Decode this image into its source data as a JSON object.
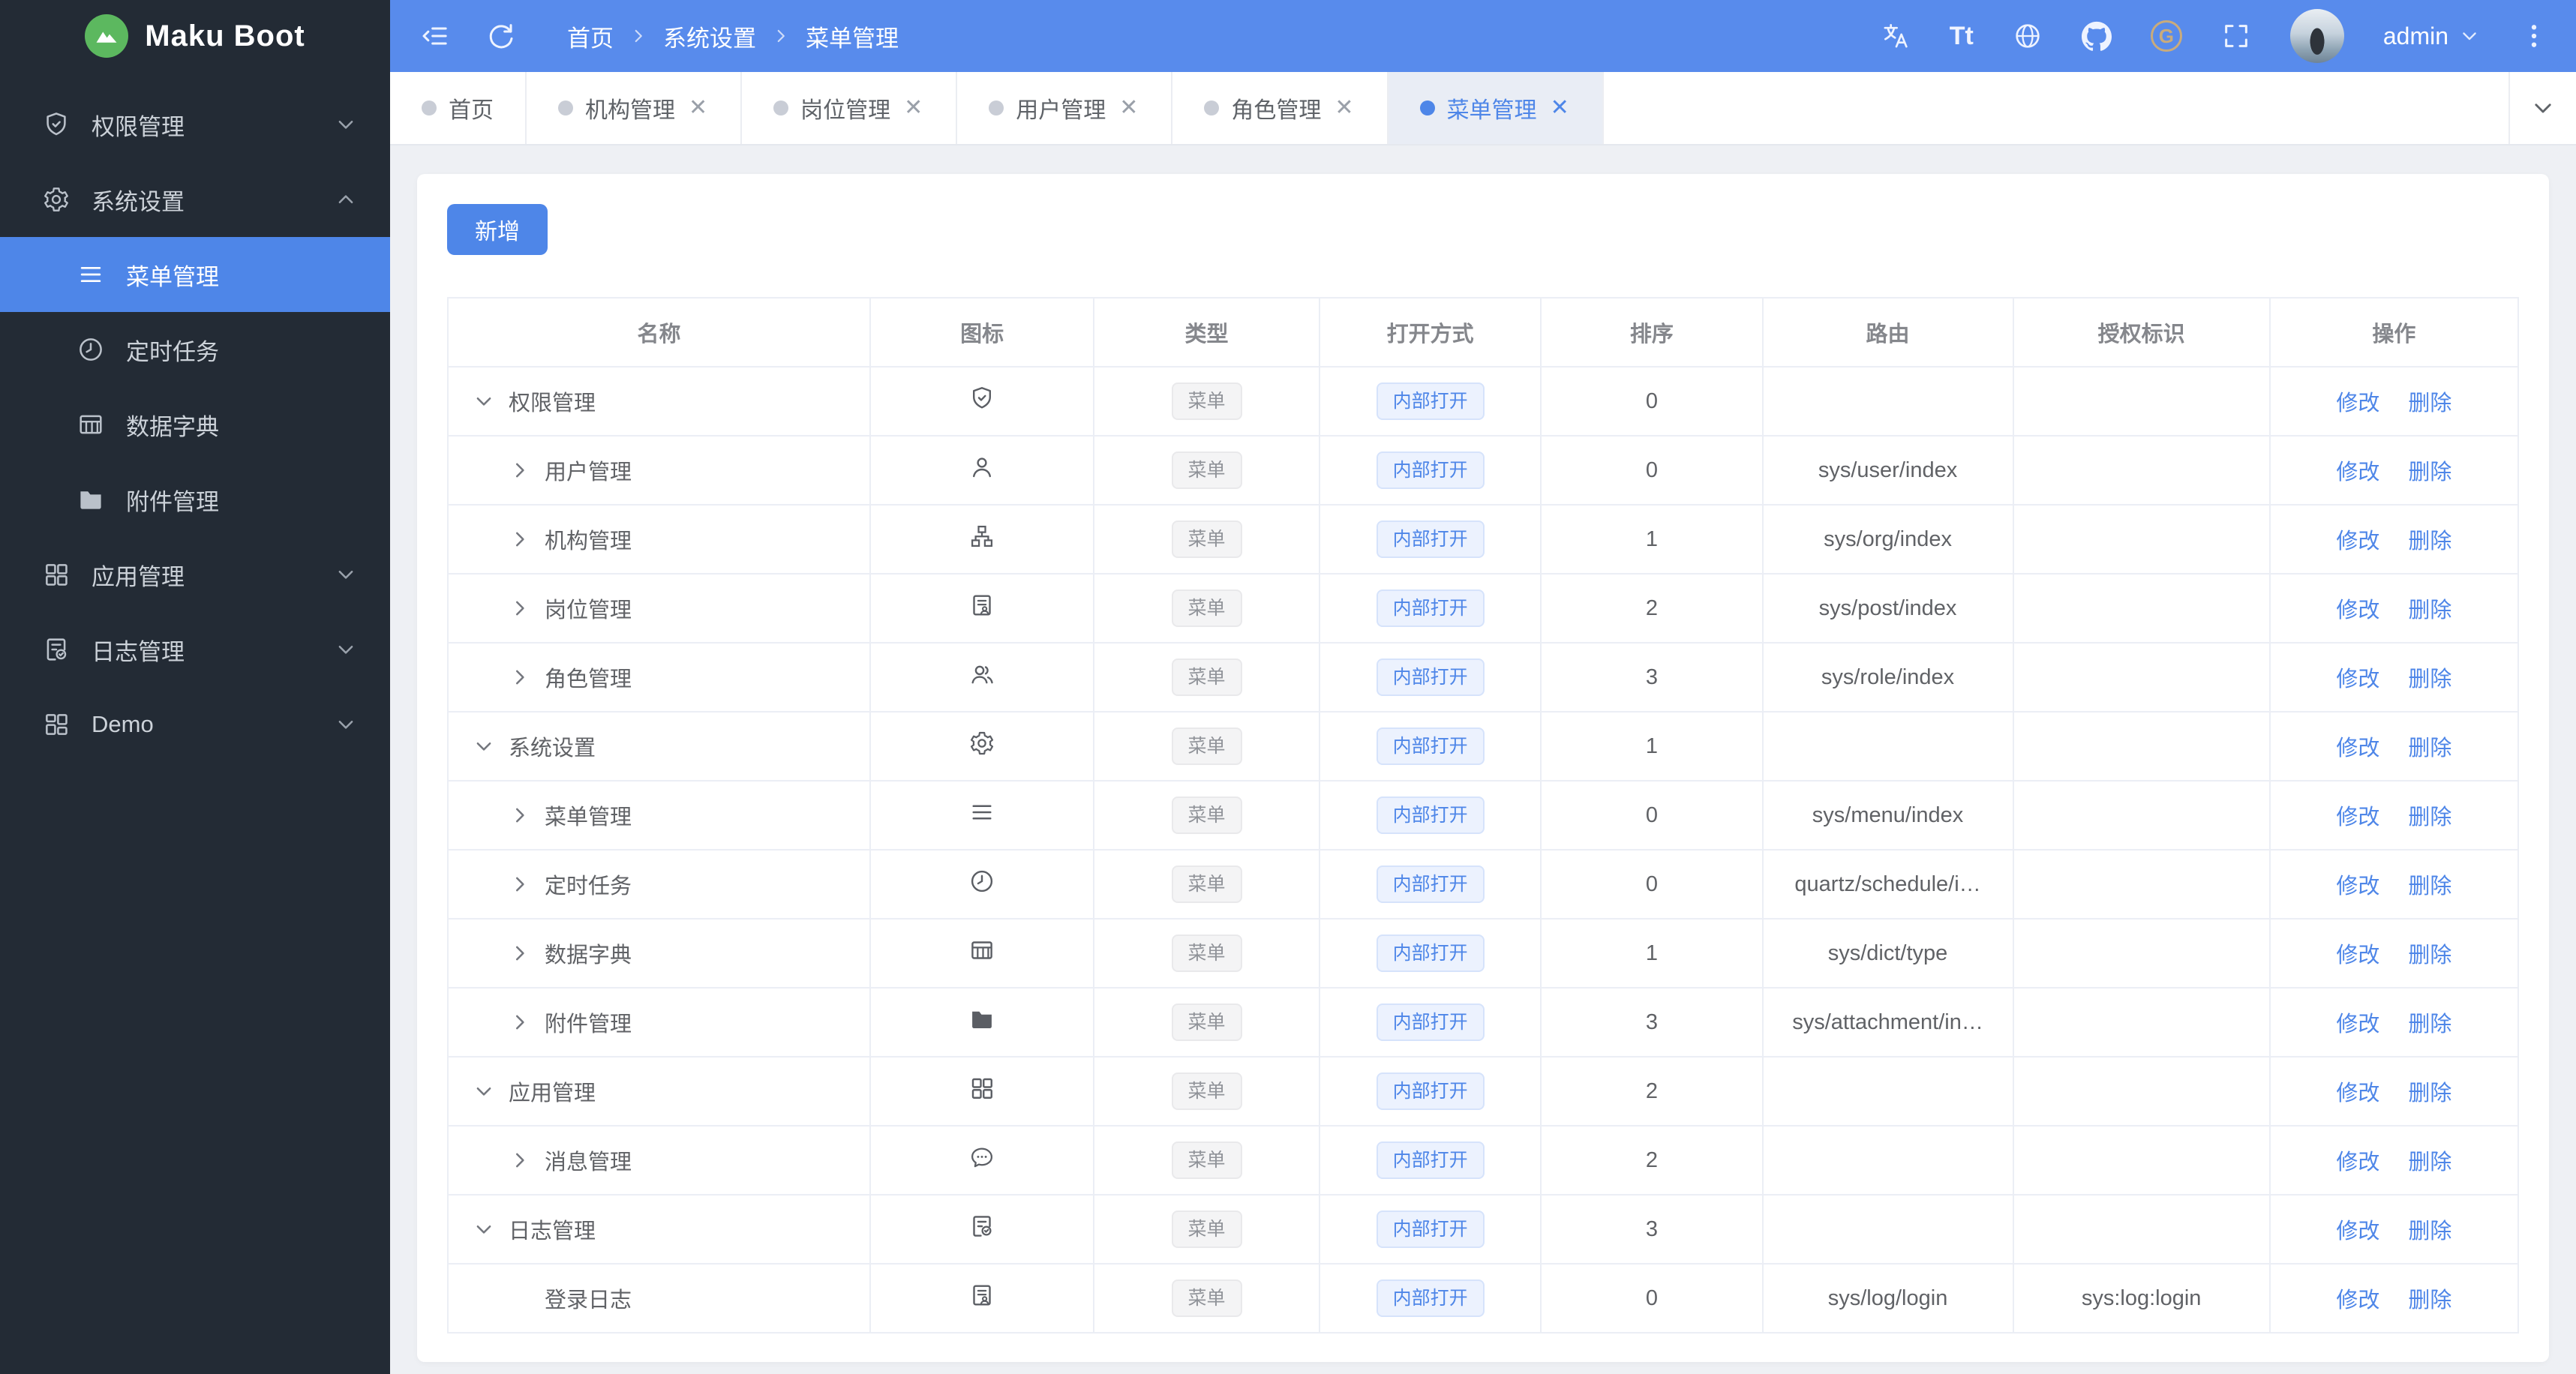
{
  "app": {
    "name": "Maku Boot"
  },
  "header": {
    "breadcrumb": [
      "首页",
      "系统设置",
      "菜单管理"
    ],
    "username": "admin",
    "font_glyph": "Tt",
    "gitee_glyph": "G"
  },
  "sidebar": {
    "items": [
      {
        "label": "权限管理"
      },
      {
        "label": "系统设置"
      },
      {
        "label": "菜单管理"
      },
      {
        "label": "定时任务"
      },
      {
        "label": "数据字典"
      },
      {
        "label": "附件管理"
      },
      {
        "label": "应用管理"
      },
      {
        "label": "日志管理"
      },
      {
        "label": "Demo"
      }
    ]
  },
  "tabs": [
    {
      "label": "首页"
    },
    {
      "label": "机构管理"
    },
    {
      "label": "岗位管理"
    },
    {
      "label": "用户管理"
    },
    {
      "label": "角色管理"
    },
    {
      "label": "菜单管理"
    }
  ],
  "tab_close_glyph": "✕",
  "toolbar": {
    "add_label": "新增"
  },
  "table": {
    "columns": [
      "名称",
      "图标",
      "类型",
      "打开方式",
      "排序",
      "路由",
      "授权标识",
      "操作"
    ],
    "type_label": "菜单",
    "open_label": "内部打开",
    "edit_label": "修改",
    "delete_label": "删除",
    "rows": [
      {
        "name": "权限管理",
        "sort": "0",
        "route": "",
        "auth": ""
      },
      {
        "name": "用户管理",
        "sort": "0",
        "route": "sys/user/index",
        "auth": ""
      },
      {
        "name": "机构管理",
        "sort": "1",
        "route": "sys/org/index",
        "auth": ""
      },
      {
        "name": "岗位管理",
        "sort": "2",
        "route": "sys/post/index",
        "auth": ""
      },
      {
        "name": "角色管理",
        "sort": "3",
        "route": "sys/role/index",
        "auth": ""
      },
      {
        "name": "系统设置",
        "sort": "1",
        "route": "",
        "auth": ""
      },
      {
        "name": "菜单管理",
        "sort": "0",
        "route": "sys/menu/index",
        "auth": ""
      },
      {
        "name": "定时任务",
        "sort": "0",
        "route": "quartz/schedule/i…",
        "auth": ""
      },
      {
        "name": "数据字典",
        "sort": "1",
        "route": "sys/dict/type",
        "auth": ""
      },
      {
        "name": "附件管理",
        "sort": "3",
        "route": "sys/attachment/in…",
        "auth": ""
      },
      {
        "name": "应用管理",
        "sort": "2",
        "route": "",
        "auth": ""
      },
      {
        "name": "消息管理",
        "sort": "2",
        "route": "",
        "auth": ""
      },
      {
        "name": "日志管理",
        "sort": "3",
        "route": "",
        "auth": ""
      },
      {
        "name": "登录日志",
        "sort": "0",
        "route": "sys/log/login",
        "auth": "sys:log:login"
      }
    ]
  },
  "colors": {
    "accent": "#4e86e8",
    "header": "#588bec",
    "sidebar": "#232b35"
  }
}
